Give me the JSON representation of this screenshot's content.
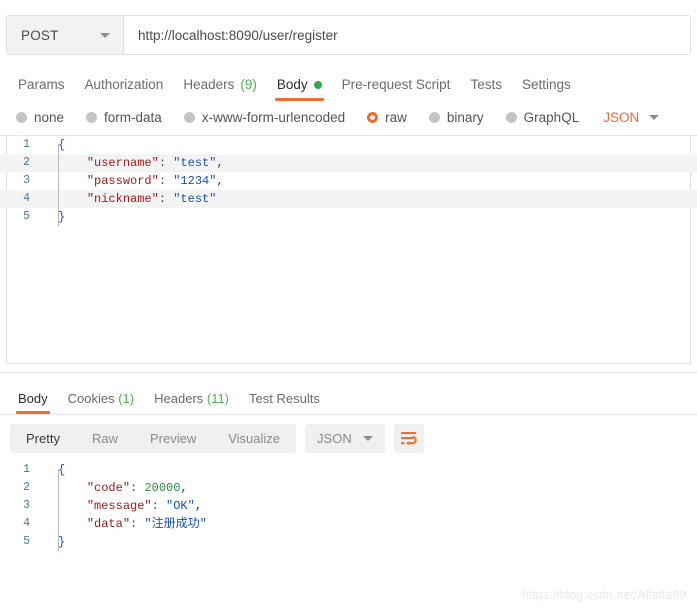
{
  "request": {
    "method": "POST",
    "url": "http://localhost:8090/user/register",
    "tabs": [
      {
        "label": "Params",
        "count": "",
        "active": false
      },
      {
        "label": "Authorization",
        "count": "",
        "active": false
      },
      {
        "label": "Headers",
        "count": "(9)",
        "active": false
      },
      {
        "label": "Body",
        "count": "",
        "active": true
      },
      {
        "label": "Pre-request Script",
        "count": "",
        "active": false
      },
      {
        "label": "Tests",
        "count": "",
        "active": false
      },
      {
        "label": "Settings",
        "count": "",
        "active": false
      }
    ],
    "body_types": [
      {
        "label": "none",
        "selected": false
      },
      {
        "label": "form-data",
        "selected": false
      },
      {
        "label": "x-www-form-urlencoded",
        "selected": false
      },
      {
        "label": "raw",
        "selected": true
      },
      {
        "label": "binary",
        "selected": false
      },
      {
        "label": "GraphQL",
        "selected": false
      }
    ],
    "format_label": "JSON",
    "body_lines": [
      {
        "n": "1",
        "brace": "{"
      },
      {
        "n": "2",
        "key": "\"username\"",
        "colon": ": ",
        "str": "\"test\"",
        "tail": ","
      },
      {
        "n": "3",
        "key": "\"password\"",
        "colon": ": ",
        "str": "\"1234\"",
        "tail": ","
      },
      {
        "n": "4",
        "key": "\"nickname\"",
        "colon": ": ",
        "str": "\"test\"",
        "tail": ""
      },
      {
        "n": "5",
        "brace": "}"
      }
    ]
  },
  "response": {
    "tabs": [
      {
        "label": "Body",
        "count": "",
        "active": true
      },
      {
        "label": "Cookies",
        "count": "(1)",
        "active": false
      },
      {
        "label": "Headers",
        "count": "(11)",
        "active": false
      },
      {
        "label": "Test Results",
        "count": "",
        "active": false
      }
    ],
    "views": [
      {
        "label": "Pretty",
        "active": true
      },
      {
        "label": "Raw",
        "active": false
      },
      {
        "label": "Preview",
        "active": false
      },
      {
        "label": "Visualize",
        "active": false
      }
    ],
    "format_label": "JSON",
    "wrap_icon": "word-wrap-icon",
    "body_lines": [
      {
        "n": "1",
        "brace": "{"
      },
      {
        "n": "2",
        "key": "\"code\"",
        "colon": ": ",
        "num": "20000",
        "tail": ","
      },
      {
        "n": "3",
        "key": "\"message\"",
        "colon": ": ",
        "str": "\"OK\"",
        "tail": ","
      },
      {
        "n": "4",
        "key": "\"data\"",
        "colon": ": ",
        "str": "\"注册成功\"",
        "tail": ""
      },
      {
        "n": "5",
        "brace": "}"
      }
    ]
  },
  "watermark": "https://blog.csdn.net/Alfalfa99",
  "colors": {
    "accent_orange": "#ef6c35",
    "status_green": "#2fa84f",
    "count_green": "#4caf50",
    "json_key": "#a01b1b",
    "json_string": "#1a52ad",
    "json_number": "#2b8a3e",
    "line_number": "#4a7ba6"
  }
}
